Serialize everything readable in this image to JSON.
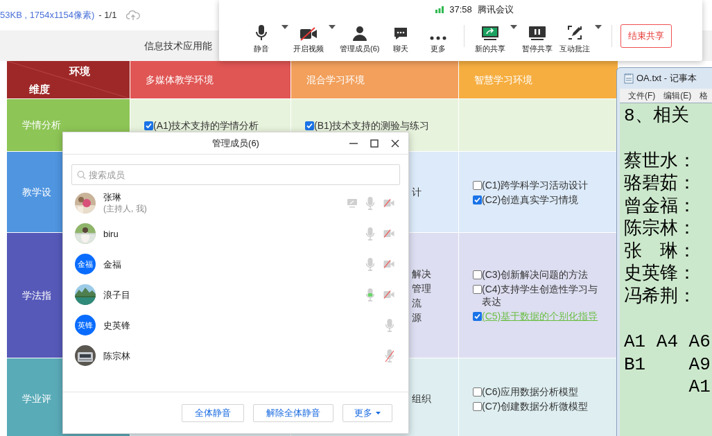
{
  "viewer": {
    "file_info": "53KB , 1754x1154像素)",
    "page": "- 1/1",
    "page_title": "信息技术应用能"
  },
  "table": {
    "corner": {
      "top": "环境",
      "bottom": "维度",
      "color": "#9e2828"
    },
    "columns": [
      {
        "label": "多媒体教学环境",
        "color": "#e05654"
      },
      {
        "label": "混合学习环境",
        "color": "#f2a05c"
      },
      {
        "label": "智慧学习环境",
        "color": "#f6ae40"
      }
    ],
    "rows": [
      {
        "label": "学情分析",
        "color": "#8dc556",
        "cells": [
          [
            {
              "kind": "option",
              "text": "(A1)技术支持的学情分析",
              "checked": true
            }
          ],
          [
            {
              "kind": "option",
              "text": "(B1)技术支持的测验与练习",
              "checked": true
            }
          ],
          []
        ]
      },
      {
        "label": "教学设",
        "color": "#4f95e0",
        "cells": [
          [],
          [
            {
              "kind": "fragment",
              "text": "计"
            }
          ],
          [
            {
              "kind": "option",
              "text": "(C1)跨学科学习活动设计",
              "checked": false
            },
            {
              "kind": "option",
              "text": "(C2)创造真实学习情境",
              "checked": true
            }
          ]
        ]
      },
      {
        "label": "学法指",
        "color": "#5659b8",
        "cells": [
          [],
          [
            {
              "kind": "fragment",
              "text": "解决"
            },
            {
              "kind": "fragment",
              "text": "管理"
            },
            {
              "kind": "fragment",
              "text": "流"
            },
            {
              "kind": "fragment",
              "text": "源"
            }
          ],
          [
            {
              "kind": "option",
              "text": "(C3)创新解决问题的方法",
              "checked": false
            },
            {
              "kind": "option",
              "text": "(C4)支持学生创造性学习与表达",
              "checked": false
            },
            {
              "kind": "option",
              "text": "(C5)基于数据的个别化指导",
              "checked": true,
              "link": true
            }
          ]
        ]
      },
      {
        "label": "学业评",
        "color": "#5aabb8",
        "cells": [
          [],
          [
            {
              "kind": "fragment",
              "text": "组织"
            }
          ],
          [
            {
              "kind": "option",
              "text": "(C6)应用数据分析模型",
              "checked": false
            },
            {
              "kind": "option",
              "text": "(C7)创建数据分析微模型",
              "checked": false
            }
          ]
        ]
      }
    ]
  },
  "meeting_bar": {
    "time": "37:58",
    "app": "腾讯会议",
    "groups": [
      [
        {
          "kind": "mic",
          "label": "静音",
          "menu": true
        },
        {
          "kind": "camera_off",
          "label": "开启视频",
          "menu": true
        },
        {
          "kind": "members",
          "label": "管理成员(6)",
          "menu": false
        },
        {
          "kind": "chat",
          "label": "聊天",
          "menu": false
        },
        {
          "kind": "more",
          "label": "更多",
          "menu": false
        }
      ],
      [
        {
          "kind": "share",
          "label": "新的共享",
          "menu": true
        },
        {
          "kind": "pause",
          "label": "暂停共享",
          "menu": false
        },
        {
          "kind": "annotate",
          "label": "互动批注",
          "menu": true
        }
      ]
    ],
    "end_button": "结束共享"
  },
  "members_dialog": {
    "title": "管理成员(6)",
    "search": {
      "placeholder": "搜索成员"
    },
    "members": [
      {
        "name": "张琳",
        "role": "(主持人, 我)",
        "sharing": true,
        "talking": false,
        "muted": false,
        "camera_off": true
      },
      {
        "name": "biru",
        "sharing": false,
        "talking": false,
        "muted": false,
        "camera_off": true
      },
      {
        "name": "金福",
        "avatar": {
          "kind": "initials",
          "text": "金福"
        },
        "sharing": false,
        "talking": false,
        "muted": false,
        "camera_off": true
      },
      {
        "name": "浪子目",
        "sharing": false,
        "talking": true,
        "muted": false,
        "camera_off": true
      },
      {
        "name": "史英锋",
        "avatar": {
          "kind": "initials",
          "text": "英锋"
        },
        "sharing": false,
        "talking": false,
        "muted": false,
        "camera_off": false
      },
      {
        "name": "陈宗林",
        "sharing": false,
        "talking": false,
        "muted": true,
        "camera_off": false
      }
    ],
    "buttons": [
      "全体静音",
      "解除全体静音"
    ],
    "more": "更多"
  },
  "notepad": {
    "title": "OA.txt - 记事本",
    "menu": [
      "文件(F)",
      "编辑(E)",
      "格"
    ],
    "paragraphs": [
      [
        "8、相关"
      ],
      [
        "蔡世水：",
        "骆碧茹：",
        "曾金福：",
        "陈宗林：",
        "张　琳：",
        "史英锋：",
        "冯希荆："
      ],
      [
        "A1 A4 A6",
        "B1    A9",
        "      A1"
      ]
    ]
  }
}
